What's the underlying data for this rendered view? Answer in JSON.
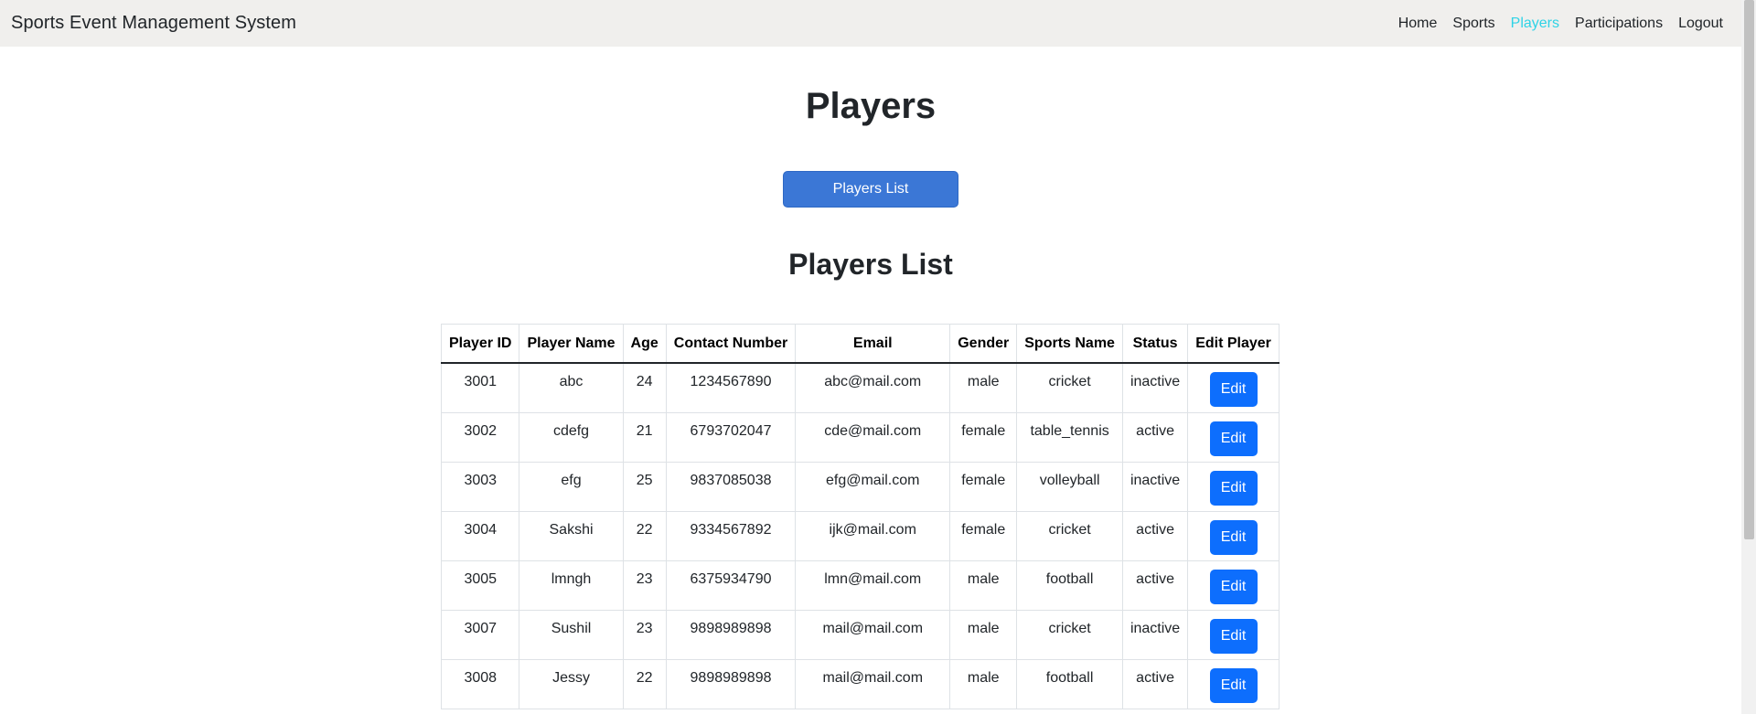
{
  "navbar": {
    "brand": "Sports Event Management System",
    "links": [
      {
        "label": "Home",
        "active": false
      },
      {
        "label": "Sports",
        "active": false
      },
      {
        "label": "Players",
        "active": true
      },
      {
        "label": "Participations",
        "active": false
      },
      {
        "label": "Logout",
        "active": false
      }
    ]
  },
  "page": {
    "title": "Players",
    "list_button": "Players List",
    "section_title": "Players List"
  },
  "table": {
    "headers": [
      "Player ID",
      "Player Name",
      "Age",
      "Contact Number",
      "Email",
      "Gender",
      "Sports Name",
      "Status",
      "Edit Player"
    ],
    "edit_label": "Edit",
    "rows": [
      [
        "3001",
        "abc",
        "24",
        "1234567890",
        "abc@mail.com",
        "male",
        "cricket",
        "inactive"
      ],
      [
        "3002",
        "cdefg",
        "21",
        "6793702047",
        "cde@mail.com",
        "female",
        "table_tennis",
        "active"
      ],
      [
        "3003",
        "efg",
        "25",
        "9837085038",
        "efg@mail.com",
        "female",
        "volleyball",
        "inactive"
      ],
      [
        "3004",
        "Sakshi",
        "22",
        "9334567892",
        "ijk@mail.com",
        "female",
        "cricket",
        "active"
      ],
      [
        "3005",
        "lmngh",
        "23",
        "6375934790",
        "lmn@mail.com",
        "male",
        "football",
        "active"
      ],
      [
        "3007",
        "Sushil",
        "23",
        "9898989898",
        "mail@mail.com",
        "male",
        "cricket",
        "inactive"
      ],
      [
        "3008",
        "Jessy",
        "22",
        "9898989898",
        "mail@mail.com",
        "male",
        "football",
        "active"
      ]
    ]
  },
  "colors": {
    "navbar_bg": "#f0efed",
    "active_link": "#2fd3e6",
    "primary_button": "#3b77d6",
    "edit_button": "#0d6efd"
  }
}
